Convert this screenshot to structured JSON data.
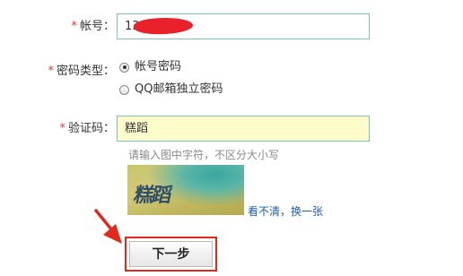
{
  "form": {
    "account": {
      "label": "帐号：",
      "value": "13               1"
    },
    "password_type": {
      "label": "密码类型：",
      "options": [
        {
          "label": "帐号密码",
          "checked": true
        },
        {
          "label": "QQ邮箱独立密码",
          "checked": false
        }
      ]
    },
    "captcha": {
      "label": "验证码：",
      "value": "糕蹈",
      "hint": "请输入图中字符，不区分大小写",
      "image_text": "糕蹈",
      "refresh_link": "看不清，换一张"
    },
    "required_mark": "*",
    "next_button": "下一步"
  },
  "colors": {
    "required": "#e4393c",
    "input_border": "#7ec3c0",
    "captcha_input_bg": "#fffccb",
    "link": "#1c5ea8",
    "annotation": "#e22a1c"
  },
  "icons": {
    "annotation_arrow": "red-arrow-icon"
  }
}
